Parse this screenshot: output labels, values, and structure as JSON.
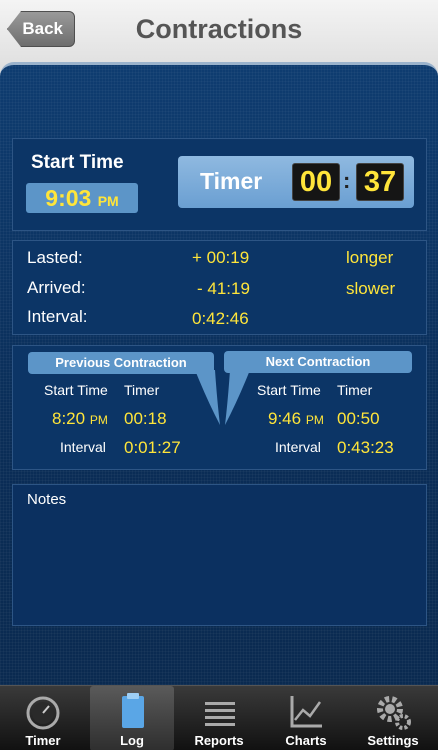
{
  "header": {
    "title": "Contractions",
    "back_label": "Back"
  },
  "start": {
    "label": "Start Time",
    "time": "9:03",
    "ampm": "PM"
  },
  "timer": {
    "label": "Timer",
    "minutes": "00",
    "seconds": "37",
    "separator": ":"
  },
  "stats": {
    "lasted_label": "Lasted:",
    "lasted_value": "+ 00:19",
    "lasted_note": "longer",
    "arrived_label": "Arrived:",
    "arrived_value": "- 41:19",
    "arrived_note": "slower",
    "interval_label": "Interval:",
    "interval_value": "0:42:46"
  },
  "previous": {
    "title": "Previous Contraction",
    "start_label": "Start Time",
    "timer_label": "Timer",
    "start_time": "8:20",
    "ampm": "PM",
    "timer": "00:18",
    "interval_label": "Interval",
    "interval": "0:01:27"
  },
  "next": {
    "title": "Next Contraction",
    "start_label": "Start Time",
    "timer_label": "Timer",
    "start_time": "9:46",
    "ampm": "PM",
    "timer": "00:50",
    "interval_label": "Interval",
    "interval": "0:43:23"
  },
  "notes": {
    "label": "Notes"
  },
  "tabs": [
    {
      "label": "Timer",
      "icon": "stopwatch-icon",
      "active": false
    },
    {
      "label": "Log",
      "icon": "clipboard-icon",
      "active": true
    },
    {
      "label": "Reports",
      "icon": "list-icon",
      "active": false
    },
    {
      "label": "Charts",
      "icon": "chart-icon",
      "active": false
    },
    {
      "label": "Settings",
      "icon": "gear-icon",
      "active": false
    }
  ],
  "colors": {
    "accent_yellow": "#ffe53a",
    "panel_blue": "#0c3566",
    "header_blue": "#5c95c8"
  }
}
